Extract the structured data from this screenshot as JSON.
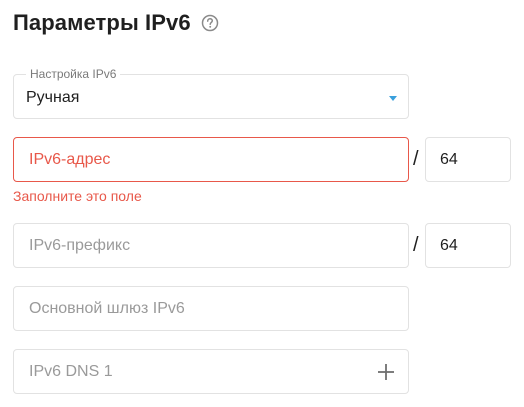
{
  "header": {
    "title": "Параметры IPv6",
    "help_icon": "question-circle-icon"
  },
  "mode_select": {
    "label": "Настройка IPv6",
    "value": "Ручная",
    "icon": "chevron-down-icon",
    "accent_color": "#3aa0dc"
  },
  "ipv6_address": {
    "placeholder": "IPv6-адрес",
    "separator": "/",
    "prefix_length": "64",
    "error": "Заполните это поле",
    "error_color": "#e8584a"
  },
  "ipv6_prefix": {
    "placeholder": "IPv6-префикс",
    "separator": "/",
    "prefix_length": "64"
  },
  "gateway": {
    "placeholder": "Основной шлюз IPv6"
  },
  "dns1": {
    "placeholder": "IPv6 DNS 1",
    "add_icon": "plus-icon"
  }
}
